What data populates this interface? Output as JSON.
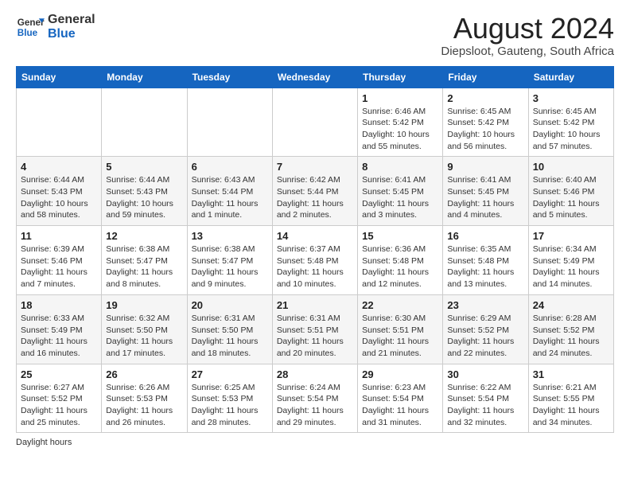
{
  "header": {
    "logo_line1": "General",
    "logo_line2": "Blue",
    "title": "August 2024",
    "subtitle": "Diepsloot, Gauteng, South Africa"
  },
  "days_of_week": [
    "Sunday",
    "Monday",
    "Tuesday",
    "Wednesday",
    "Thursday",
    "Friday",
    "Saturday"
  ],
  "weeks": [
    [
      {
        "day": "",
        "info": ""
      },
      {
        "day": "",
        "info": ""
      },
      {
        "day": "",
        "info": ""
      },
      {
        "day": "",
        "info": ""
      },
      {
        "day": "1",
        "info": "Sunrise: 6:46 AM\nSunset: 5:42 PM\nDaylight: 10 hours and 55 minutes."
      },
      {
        "day": "2",
        "info": "Sunrise: 6:45 AM\nSunset: 5:42 PM\nDaylight: 10 hours and 56 minutes."
      },
      {
        "day": "3",
        "info": "Sunrise: 6:45 AM\nSunset: 5:42 PM\nDaylight: 10 hours and 57 minutes."
      }
    ],
    [
      {
        "day": "4",
        "info": "Sunrise: 6:44 AM\nSunset: 5:43 PM\nDaylight: 10 hours and 58 minutes."
      },
      {
        "day": "5",
        "info": "Sunrise: 6:44 AM\nSunset: 5:43 PM\nDaylight: 10 hours and 59 minutes."
      },
      {
        "day": "6",
        "info": "Sunrise: 6:43 AM\nSunset: 5:44 PM\nDaylight: 11 hours and 1 minute."
      },
      {
        "day": "7",
        "info": "Sunrise: 6:42 AM\nSunset: 5:44 PM\nDaylight: 11 hours and 2 minutes."
      },
      {
        "day": "8",
        "info": "Sunrise: 6:41 AM\nSunset: 5:45 PM\nDaylight: 11 hours and 3 minutes."
      },
      {
        "day": "9",
        "info": "Sunrise: 6:41 AM\nSunset: 5:45 PM\nDaylight: 11 hours and 4 minutes."
      },
      {
        "day": "10",
        "info": "Sunrise: 6:40 AM\nSunset: 5:46 PM\nDaylight: 11 hours and 5 minutes."
      }
    ],
    [
      {
        "day": "11",
        "info": "Sunrise: 6:39 AM\nSunset: 5:46 PM\nDaylight: 11 hours and 7 minutes."
      },
      {
        "day": "12",
        "info": "Sunrise: 6:38 AM\nSunset: 5:47 PM\nDaylight: 11 hours and 8 minutes."
      },
      {
        "day": "13",
        "info": "Sunrise: 6:38 AM\nSunset: 5:47 PM\nDaylight: 11 hours and 9 minutes."
      },
      {
        "day": "14",
        "info": "Sunrise: 6:37 AM\nSunset: 5:48 PM\nDaylight: 11 hours and 10 minutes."
      },
      {
        "day": "15",
        "info": "Sunrise: 6:36 AM\nSunset: 5:48 PM\nDaylight: 11 hours and 12 minutes."
      },
      {
        "day": "16",
        "info": "Sunrise: 6:35 AM\nSunset: 5:48 PM\nDaylight: 11 hours and 13 minutes."
      },
      {
        "day": "17",
        "info": "Sunrise: 6:34 AM\nSunset: 5:49 PM\nDaylight: 11 hours and 14 minutes."
      }
    ],
    [
      {
        "day": "18",
        "info": "Sunrise: 6:33 AM\nSunset: 5:49 PM\nDaylight: 11 hours and 16 minutes."
      },
      {
        "day": "19",
        "info": "Sunrise: 6:32 AM\nSunset: 5:50 PM\nDaylight: 11 hours and 17 minutes."
      },
      {
        "day": "20",
        "info": "Sunrise: 6:31 AM\nSunset: 5:50 PM\nDaylight: 11 hours and 18 minutes."
      },
      {
        "day": "21",
        "info": "Sunrise: 6:31 AM\nSunset: 5:51 PM\nDaylight: 11 hours and 20 minutes."
      },
      {
        "day": "22",
        "info": "Sunrise: 6:30 AM\nSunset: 5:51 PM\nDaylight: 11 hours and 21 minutes."
      },
      {
        "day": "23",
        "info": "Sunrise: 6:29 AM\nSunset: 5:52 PM\nDaylight: 11 hours and 22 minutes."
      },
      {
        "day": "24",
        "info": "Sunrise: 6:28 AM\nSunset: 5:52 PM\nDaylight: 11 hours and 24 minutes."
      }
    ],
    [
      {
        "day": "25",
        "info": "Sunrise: 6:27 AM\nSunset: 5:52 PM\nDaylight: 11 hours and 25 minutes."
      },
      {
        "day": "26",
        "info": "Sunrise: 6:26 AM\nSunset: 5:53 PM\nDaylight: 11 hours and 26 minutes."
      },
      {
        "day": "27",
        "info": "Sunrise: 6:25 AM\nSunset: 5:53 PM\nDaylight: 11 hours and 28 minutes."
      },
      {
        "day": "28",
        "info": "Sunrise: 6:24 AM\nSunset: 5:54 PM\nDaylight: 11 hours and 29 minutes."
      },
      {
        "day": "29",
        "info": "Sunrise: 6:23 AM\nSunset: 5:54 PM\nDaylight: 11 hours and 31 minutes."
      },
      {
        "day": "30",
        "info": "Sunrise: 6:22 AM\nSunset: 5:54 PM\nDaylight: 11 hours and 32 minutes."
      },
      {
        "day": "31",
        "info": "Sunrise: 6:21 AM\nSunset: 5:55 PM\nDaylight: 11 hours and 34 minutes."
      }
    ]
  ],
  "footer": {
    "note": "Daylight hours"
  }
}
